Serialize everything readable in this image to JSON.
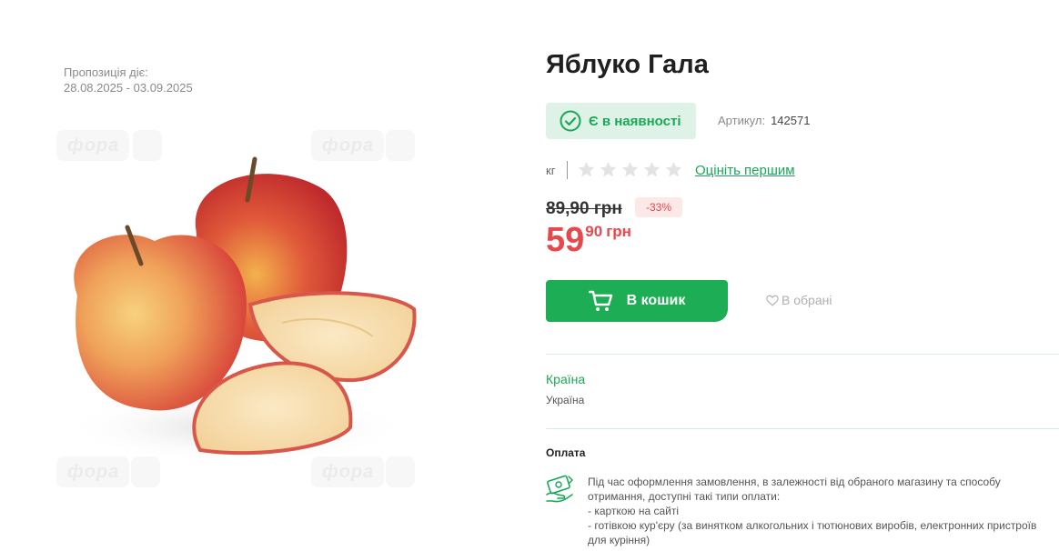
{
  "offer": {
    "label": "Пропозиція діє:",
    "dates": "28.08.2025 - 03.09.2025"
  },
  "watermark": {
    "text": "фора"
  },
  "product": {
    "title": "Яблуко Гала",
    "stock": "Є в наявності",
    "sku_label": "Артикул:",
    "sku": "142571",
    "unit": "кг",
    "rating": 0,
    "rating_max": 5,
    "rate_link": "Оцініть першим"
  },
  "price": {
    "old": "89,90 грн",
    "discount": "-33%",
    "new_int": "59",
    "new_dec": "90",
    "currency": "грн"
  },
  "actions": {
    "cart": "В кошик",
    "favorite": "В обрані"
  },
  "details": {
    "country_label": "Країна",
    "country": "Україна",
    "payment_label": "Оплата",
    "payment_lines": [
      "Під час оформлення замовлення, в залежності від обраного магазину та способу",
      "отримання, доступні такі типи оплати:",
      "- карткою на сайті",
      "- готівкою кур'єру (за винятком алкогольних і тютюнових виробів, електронних пристроїв",
      "для куріння)"
    ]
  },
  "colors": {
    "accent": "#1cad55",
    "price": "#e5484d",
    "stock_bg": "#dff2e7"
  }
}
